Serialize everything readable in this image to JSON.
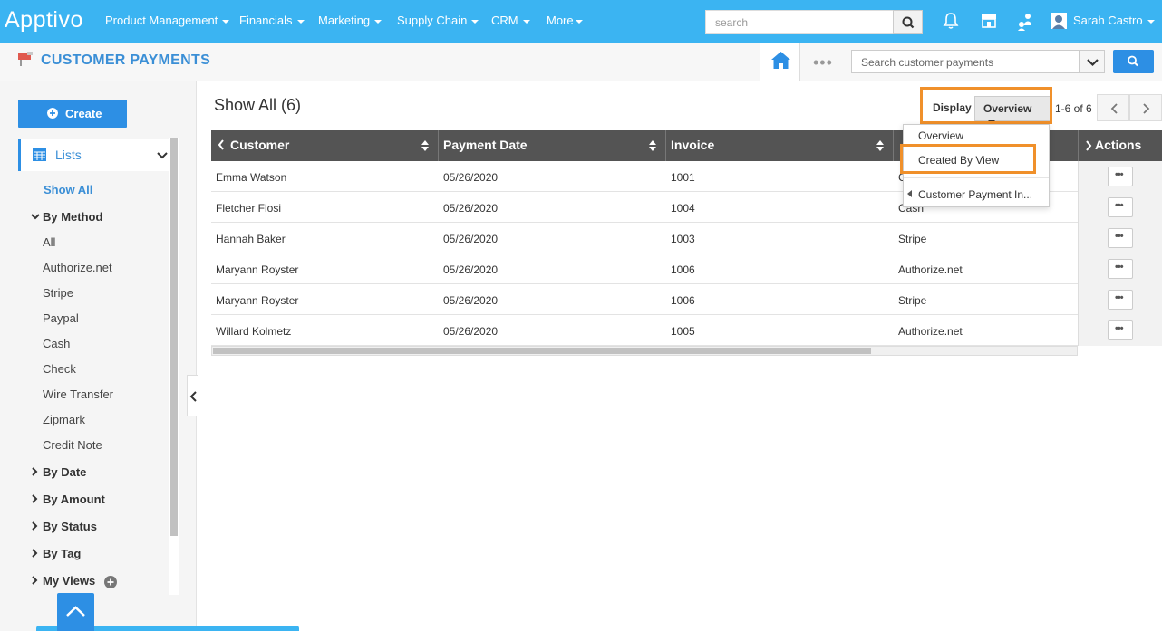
{
  "app": {
    "logo": "Apptivo",
    "nav": [
      {
        "label": "Product Management"
      },
      {
        "label": "Financials"
      },
      {
        "label": "Marketing"
      },
      {
        "label": "Supply Chain"
      },
      {
        "label": "CRM"
      },
      {
        "label": "More"
      }
    ],
    "search_placeholder": "search",
    "user_name": "Sarah Castro"
  },
  "page": {
    "title": "CUSTOMER PAYMENTS",
    "search_placeholder": "Search customer payments"
  },
  "sidebar": {
    "create_label": "Create",
    "lists_label": "Lists",
    "show_all": "Show All",
    "by_method": "By Method",
    "methods": [
      "All",
      "Authorize.net",
      "Stripe",
      "Paypal",
      "Cash",
      "Check",
      "Wire Transfer",
      "Zipmark",
      "Credit Note"
    ],
    "groups": [
      "By Date",
      "By Amount",
      "By Status",
      "By Tag",
      "My Views"
    ]
  },
  "main": {
    "heading": "Show All (6)",
    "display_label": "Display",
    "display_value": "Overview",
    "paging": "1-6 of 6",
    "columns": [
      "Customer",
      "Payment Date",
      "Invoice",
      "Actions"
    ],
    "rows": [
      {
        "customer": "Emma Watson",
        "date": "05/26/2020",
        "invoice": "1001",
        "method": "C"
      },
      {
        "customer": "Fletcher Flosi",
        "date": "05/26/2020",
        "invoice": "1004",
        "method": "Cash"
      },
      {
        "customer": "Hannah Baker",
        "date": "05/26/2020",
        "invoice": "1003",
        "method": "Stripe"
      },
      {
        "customer": "Maryann Royster",
        "date": "05/26/2020",
        "invoice": "1006",
        "method": "Authorize.net"
      },
      {
        "customer": "Maryann Royster",
        "date": "05/26/2020",
        "invoice": "1006",
        "method": "Stripe"
      },
      {
        "customer": "Willard Kolmetz",
        "date": "05/26/2020",
        "invoice": "1005",
        "method": "Authorize.net"
      }
    ],
    "action_glyph": "•••",
    "dropdown": {
      "items": [
        "Overview",
        "Created By View",
        "Customer Payment In..."
      ]
    }
  },
  "colors": {
    "topbar": "#3bb4f2",
    "accent": "#2d8fe4",
    "highlight": "#f0902a",
    "table_header": "#545454"
  }
}
